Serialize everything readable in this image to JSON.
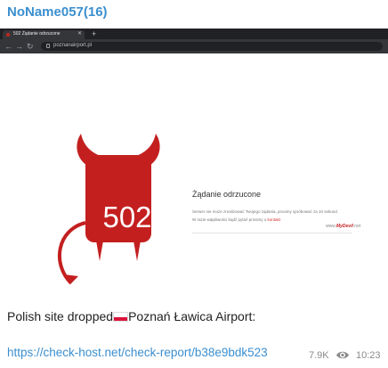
{
  "post": {
    "channel_name": "NoName057(16)",
    "caption_prefix": "Polish site dropped",
    "caption_suffix": "Poznań Ławica Airport:",
    "link": "https://check-host.net/check-report/b38e9bdk523",
    "views": "7.9K",
    "time": "10:23",
    "flag": "poland-flag"
  },
  "screenshot": {
    "tab_title": "502 Żądanie odrzucone",
    "url": "poznanairport.pl",
    "error_code": "502",
    "error_title": "Żądanie odrzucone",
    "error_line1": "Serwer nie może zrealizować Twojego żądania, prosimy spróbować za 10 sekund.",
    "error_line2_prefix": "W razie wątpliwości bądź pytań prosimy o ",
    "error_line2_link": "kontakt",
    "brand_prefix": "www.",
    "brand_name": "MyDevil",
    "brand_suffix": ".net",
    "colors": {
      "devil_red": "#c41f1f",
      "chrome_dark": "#202124",
      "link_blue": "#3b8fd0"
    }
  }
}
